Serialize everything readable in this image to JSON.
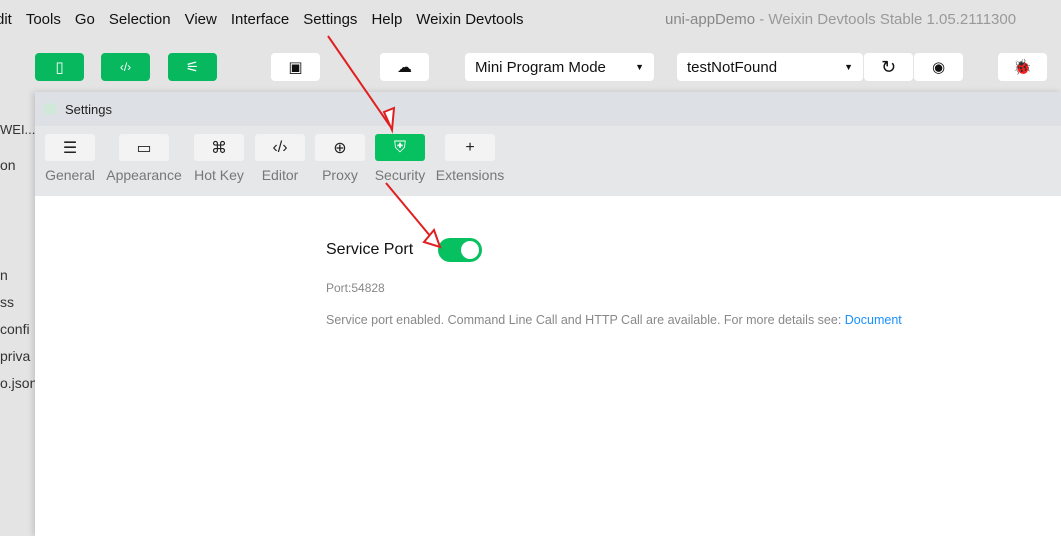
{
  "menu": [
    "dit",
    "Tools",
    "Go",
    "Selection",
    "View",
    "Interface",
    "Settings",
    "Help",
    "Weixin Devtools"
  ],
  "window": {
    "project": "uni-appDemo",
    "separator": "-",
    "title": "Weixin Devtools Stable 1.05.2111300"
  },
  "toolbar": {
    "mode": "Mini Program Mode",
    "compile": "testNotFound",
    "icons": [
      "simulator-icon",
      "editor-icon",
      "debugger-icon",
      "layout-icon",
      "cloud-icon",
      "refresh-icon",
      "preview-icon",
      "bug-icon"
    ]
  },
  "sidebar": [
    "WEI...",
    "on",
    "n",
    "ss",
    "confi",
    "priva",
    "o.json"
  ],
  "dialog": {
    "title": "Settings",
    "tabs": [
      {
        "label": "General",
        "icon": "☰"
      },
      {
        "label": "Appearance",
        "icon": "▭"
      },
      {
        "label": "Hot Key",
        "icon": "⌘"
      },
      {
        "label": "Editor",
        "icon": "‹/›"
      },
      {
        "label": "Proxy",
        "icon": "⊕"
      },
      {
        "label": "Security",
        "icon": "⛨"
      },
      {
        "label": "Extensions",
        "icon": "+"
      }
    ],
    "active_tab": "Security",
    "service_port": {
      "label": "Service Port",
      "enabled": true,
      "port": "Port:54828",
      "description": "Service port enabled. Command Line Call and HTTP Call are available. For more details see:",
      "link": "Document"
    }
  },
  "colors": {
    "accent": "#07c160",
    "link": "#1890ff",
    "annotation": "#e02020"
  }
}
